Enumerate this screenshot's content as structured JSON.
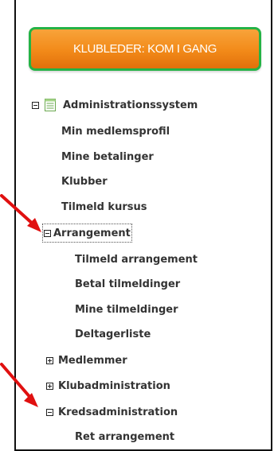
{
  "cta_button": {
    "label": "KLUBLEDER: KOM I GANG"
  },
  "tree": {
    "root": {
      "label": "Administrationssystem",
      "expanded": true,
      "icon": "document-list-icon"
    },
    "items": {
      "min_medlemsprofil": "Min medlemsprofil",
      "mine_betalinger": "Mine betalinger",
      "klubber": "Klubber",
      "tilmeld_kursus": "Tilmeld kursus",
      "arrangement": "Arrangement",
      "tilmeld_arrangement": "Tilmeld arrangement",
      "betal_tilmeldinger": "Betal tilmeldinger",
      "mine_tilmeldinger": "Mine tilmeldinger",
      "deltagerliste": "Deltagerliste",
      "medlemmer": "Medlemmer",
      "klubadministration": "Klubadministration",
      "kredsadministration": "Kredsadministration",
      "ret_arrangement": "Ret arrangement"
    }
  },
  "colors": {
    "cta_orange": "#f28a19",
    "cta_border_green": "#24b346",
    "tree_text": "#333333",
    "arrow_red": "#e01010"
  }
}
